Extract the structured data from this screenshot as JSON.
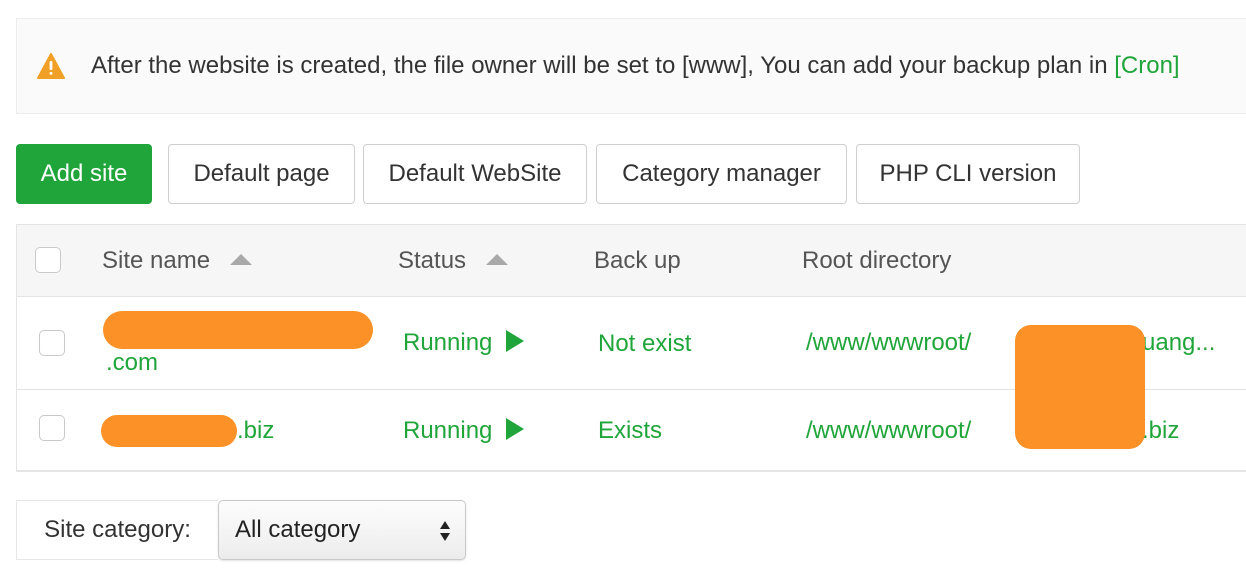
{
  "notice": {
    "text": "After the website is created, the file owner will be set to [www], You can add your backup plan in ",
    "link": "[Cron]"
  },
  "toolbar": {
    "add_site": "Add site",
    "default_page": "Default page",
    "default_website": "Default WebSite",
    "category_manager": "Category manager",
    "php_cli_version": "PHP CLI version"
  },
  "table": {
    "headers": {
      "site_name": "Site name",
      "status": "Status",
      "backup": "Back up",
      "root_directory": "Root directory"
    },
    "rows": [
      {
        "site_suffix": ".com",
        "status": "Running",
        "backup": "Not exist",
        "root_prefix": "/www/wwwroot/",
        "root_suffix": "uang..."
      },
      {
        "site_suffix": ".biz",
        "status": "Running",
        "backup": "Exists",
        "root_prefix": "/www/wwwroot/",
        "root_suffix": ".biz"
      }
    ]
  },
  "footer": {
    "category_label": "Site category:",
    "category_selected": "All category"
  },
  "colors": {
    "accent": "#20a53a",
    "warning": "#f0a026",
    "redaction": "#fb9127"
  },
  "icons": {
    "warning": "warning-triangle-icon",
    "sort": "sort-asc-icon",
    "status": "play-icon",
    "select": "updown-arrows-icon"
  }
}
